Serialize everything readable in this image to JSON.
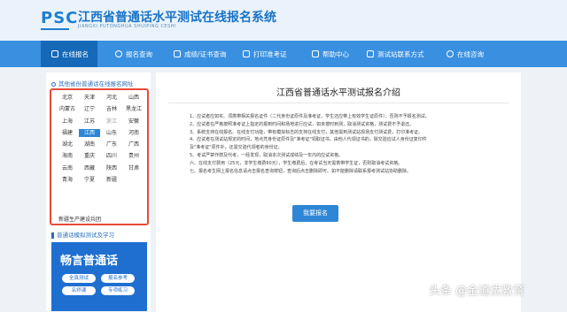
{
  "header": {
    "logo_text": "PSC",
    "title": "江西省普通话水平测试在线报名系统",
    "subtitle": "JIANGXI PUTONGHUA SHUIPING CESHI"
  },
  "nav": {
    "items": [
      {
        "label": "在线报名",
        "icon": "home-icon"
      },
      {
        "label": "报名查询",
        "icon": "search-icon"
      },
      {
        "label": "成绩/证书查询",
        "icon": "certificate-icon"
      },
      {
        "label": "打印准考证",
        "icon": "printer-icon"
      },
      {
        "label": "帮助中心",
        "icon": "help-icon"
      },
      {
        "label": "测试站联系方式",
        "icon": "contact-icon"
      },
      {
        "label": "在线咨询",
        "icon": "chat-icon"
      }
    ]
  },
  "sidebar": {
    "province_heading": "其他省份普通话在线报名网址",
    "provinces": [
      "北京",
      "天津",
      "河北",
      "山西",
      "内蒙古",
      "辽宁",
      "吉林",
      "黑龙江",
      "上海",
      "江苏",
      "浙江",
      "安徽",
      "福建",
      "江西",
      "山东",
      "河南",
      "湖北",
      "湖南",
      "广东",
      "广西",
      "海南",
      "重庆",
      "四川",
      "贵州",
      "云南",
      "西藏",
      "陕西",
      "甘肃",
      "青海",
      "宁夏",
      "新疆",
      ""
    ],
    "active_province": "江西",
    "muted_province": "浙江",
    "extra_province": "新疆生产建设兵团",
    "learn_heading": "普通话模拟测试及学习",
    "promo": {
      "title": "畅言普通话",
      "pills": [
        "全真测试",
        "报名参考",
        "名师课",
        "专项练习"
      ]
    }
  },
  "main": {
    "title": "江西省普通话水平测试报名介绍",
    "rules": [
      "1、应试者应如实、须携带相关报名证件（二代身份证原件及准考证，学生还应带上有效学生证原件），否则不予报名测试。",
      "2、应试者在严格按照准考证上指定的报到时间和场地进行应试，如未按时到测，取消测试资格，测试费不予退还。",
      "3、系统支持在线报名、在线支付功能，带有模拟标志的支持在线支付，其他需到测试站现场支付测试费，打印准考证。",
      "4、应试者在测试站规定的时间，地点凭身份证原件及\"准考证\"领取证书。由他人代领证书的，除交验应试人身份证复印件",
      "及\"准考证\"原件外，还需交验代领者的身份证。",
      "5、考试严禁作弊及代考，一经发现，取消本次测试成绩及一年内的应试资格。",
      "六、在线支付费用（25元，非学生缴费60元），学生缴费后，在考试当天需携带学生证，否则取消考试资格。",
      "七、报名考生网上报名信息请点击报名查询按钮，查询后点击删除即可。如不能删除请联系报考测试站协助删除。"
    ],
    "button_label": "我要报名"
  },
  "watermark": "头条 @金道优教育",
  "colors": {
    "accent": "#3a90e0",
    "nav_active": "#1668b8",
    "highlight_border": "#e84a3a",
    "button": "#2f86d6"
  }
}
